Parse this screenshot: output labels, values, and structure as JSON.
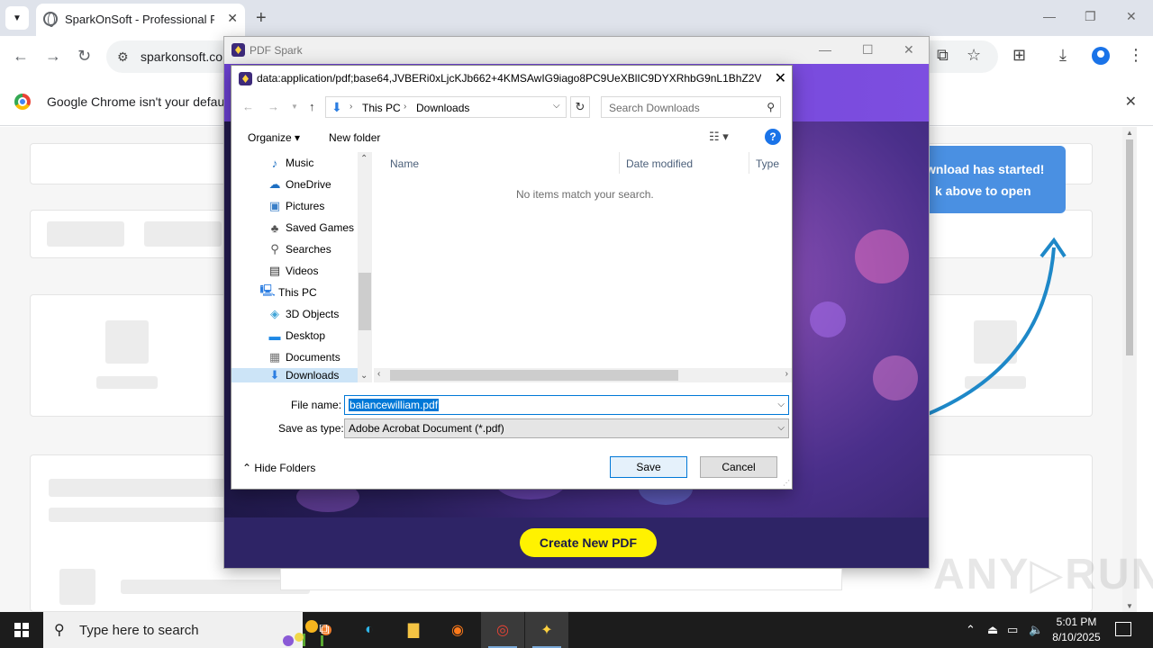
{
  "browser": {
    "tab_title": "SparkOnSoft - Professional PDF",
    "url": "sparkonsoft.co",
    "infobar_text": "Google Chrome isn't your default b"
  },
  "page": {
    "toast_line1": "wnload has started!",
    "toast_line2": "k above to open",
    "watermark": "ANY RUN"
  },
  "app": {
    "title": "PDF Spark",
    "create_button": "Create New PDF"
  },
  "dialog": {
    "title": "data:application/pdf;base64,JVBERi0xLjcKJb662+4KMSAwIG9iago8PC9UeXBlIC9DYXRhbG9nL1BhZ2VzIDI...",
    "address": {
      "segments": [
        "This PC",
        "Downloads"
      ]
    },
    "search_placeholder": "Search Downloads",
    "commands": {
      "organize": "Organize",
      "new_folder": "New folder"
    },
    "tree": [
      {
        "label": "Music",
        "icon": "music-icon"
      },
      {
        "label": "OneDrive",
        "icon": "cloud-icon"
      },
      {
        "label": "Pictures",
        "icon": "pictures-icon"
      },
      {
        "label": "Saved Games",
        "icon": "saved-games-icon"
      },
      {
        "label": "Searches",
        "icon": "search-icon"
      },
      {
        "label": "Videos",
        "icon": "videos-icon"
      },
      {
        "label": "This PC",
        "icon": "computer-icon"
      },
      {
        "label": "3D Objects",
        "icon": "cube-icon"
      },
      {
        "label": "Desktop",
        "icon": "desktop-icon"
      },
      {
        "label": "Documents",
        "icon": "documents-icon"
      },
      {
        "label": "Downloads",
        "icon": "download-icon",
        "selected": true
      }
    ],
    "columns": {
      "name": "Name",
      "date_modified": "Date modified",
      "type": "Type"
    },
    "empty_message": "No items match your search.",
    "file_name_label": "File name:",
    "file_name_value": "balancewilliam.pdf",
    "save_type_label": "Save as type:",
    "save_type_value": "Adobe Acrobat Document (*.pdf)",
    "hide_folders": "Hide Folders",
    "save_button": "Save",
    "cancel_button": "Cancel"
  },
  "taskbar": {
    "search_placeholder": "Type here to search",
    "time": "5:01 PM",
    "date": "8/10/2025"
  },
  "colors": {
    "accent": "#0078d7",
    "app_header": "#6a3fd0",
    "create_button": "#fff200",
    "toast": "#4a90e2"
  }
}
